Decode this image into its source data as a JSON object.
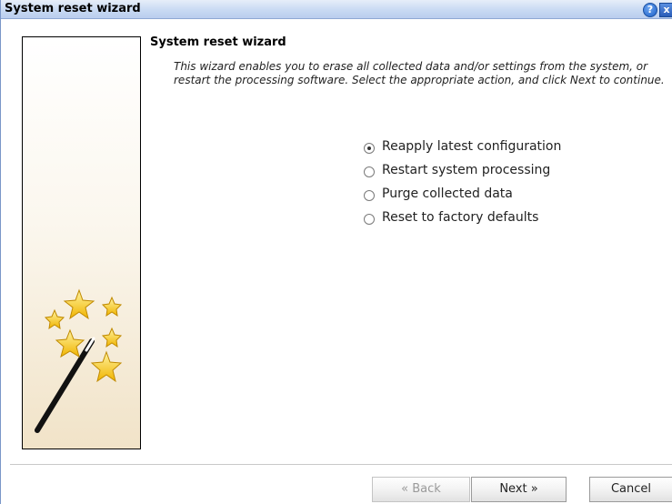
{
  "window": {
    "title": "System reset wizard",
    "help_icon": "?",
    "close_icon": "x"
  },
  "content": {
    "title": "System reset wizard",
    "description": "This wizard enables you to erase all collected data and/or settings from the system, or restart the processing software. Select the appropriate action, and click Next to continue."
  },
  "options": [
    {
      "label": "Reapply latest configuration",
      "checked": true
    },
    {
      "label": "Restart system processing",
      "checked": false
    },
    {
      "label": "Purge collected data",
      "checked": false
    },
    {
      "label": "Reset to factory defaults",
      "checked": false
    }
  ],
  "buttons": {
    "back_label": "« Back",
    "next_label": "Next »",
    "cancel_label": "Cancel"
  },
  "colors": {
    "titlebar": "#c9daf3",
    "star": "#f4c20d",
    "wand": "#111111"
  }
}
